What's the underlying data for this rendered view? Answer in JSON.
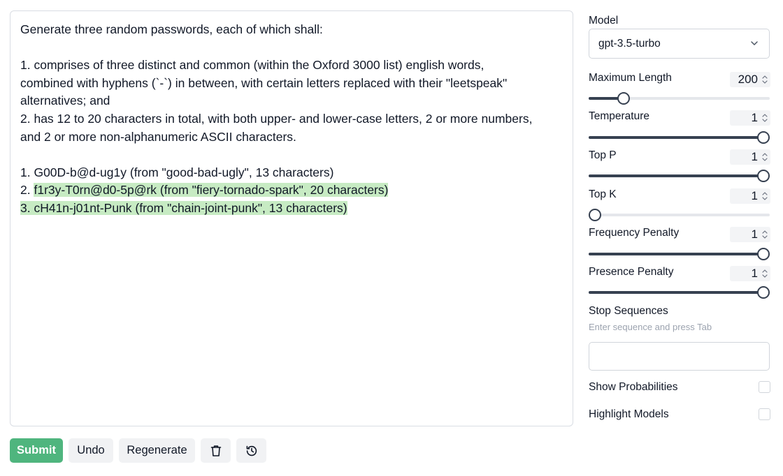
{
  "editor": {
    "lines": [
      "Generate three random passwords, each of which shall:",
      "",
      "1. comprises of three distinct and common (within the Oxford 3000 list) english words,",
      "combined with hyphens (`-`) in between, with certain letters replaced with their \"leetspeak\"",
      "alternatives; and",
      "2. has 12 to 20 characters in total, with both upper- and lower-case letters, 2 or more numbers,",
      "and 2 or more non-alphanumeric ASCII characters.",
      "",
      "1. G00D-b@d-ug1y (from \"good-bad-ugly\", 13 characters)"
    ],
    "completion_line_2_prefix": "2. ",
    "completion_line_2": "f1r3y-T0rn@d0-5p@rk (from \"fiery-tornado-spark\", 20 characters)",
    "completion_line_3": "3. cH41n-j01nt-Punk (from \"chain-joint-punk\", 13 characters)",
    "highlight_color": "#c7ebc3"
  },
  "buttons": {
    "submit": "Submit",
    "undo": "Undo",
    "regenerate": "Regenerate",
    "delete_icon": "trash-icon",
    "history_icon": "history-icon",
    "submit_color": "#4fb57e"
  },
  "settings": {
    "model_label": "Model",
    "model_value": "gpt-3.5-turbo",
    "sliders": [
      {
        "label": "Maximum Length",
        "value": "200",
        "fraction": 0.17
      },
      {
        "label": "Temperature",
        "value": "1",
        "fraction": 1.0
      },
      {
        "label": "Top P",
        "value": "1",
        "fraction": 1.0
      },
      {
        "label": "Top K",
        "value": "1",
        "fraction": 0.0
      },
      {
        "label": "Frequency Penalty",
        "value": "1",
        "fraction": 1.0
      },
      {
        "label": "Presence Penalty",
        "value": "1",
        "fraction": 1.0
      }
    ],
    "stop_sequences_label": "Stop Sequences",
    "stop_sequences_hint": "Enter sequence and press Tab",
    "stop_sequences_value": "",
    "show_probabilities_label": "Show Probabilities",
    "show_probabilities_checked": false,
    "highlight_models_label": "Highlight Models",
    "highlight_models_checked": false
  }
}
